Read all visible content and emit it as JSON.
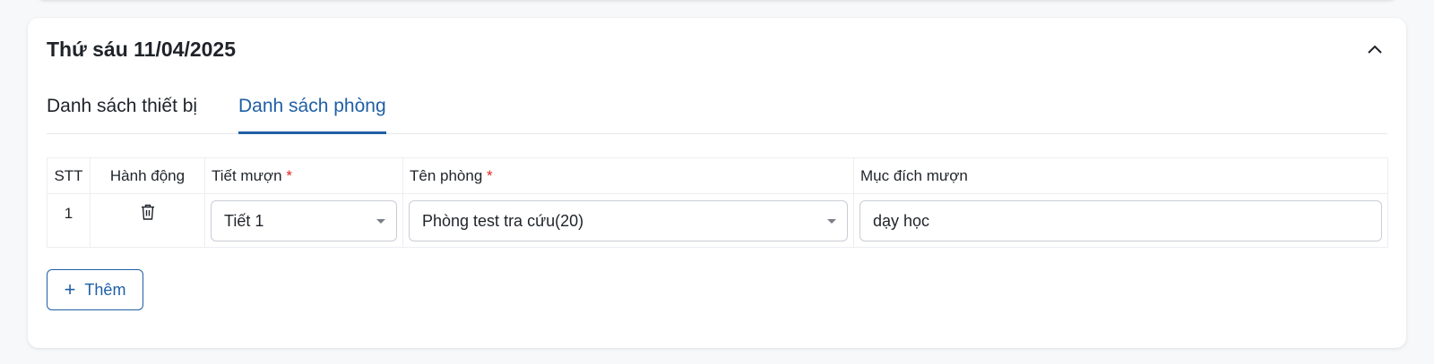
{
  "day_section": {
    "title": "Thứ sáu 11/04/2025",
    "tabs": [
      "Danh sách thiết bị",
      "Danh sách phòng"
    ],
    "active_tab": "Danh sách phòng"
  },
  "table": {
    "headers": {
      "stt": "STT",
      "action": "Hành động",
      "period": "Tiết mượn",
      "room": "Tên phòng",
      "purpose": "Mục đích mượn"
    },
    "required_mark": "*",
    "rows": [
      {
        "stt": "1",
        "period": "Tiết 1",
        "room": "Phòng test tra cứu(20)",
        "purpose": "dạy học"
      }
    ]
  },
  "add_button": {
    "icon": "+",
    "label": "Thêm"
  },
  "icons": {
    "collapse": "chevron-up-icon",
    "delete": "trash-icon",
    "dropdown": "caret-down-icon"
  },
  "colors": {
    "accent": "#1f5fa6",
    "required": "#e02424",
    "text": "#1f2329",
    "border": "#c9cdd4"
  }
}
